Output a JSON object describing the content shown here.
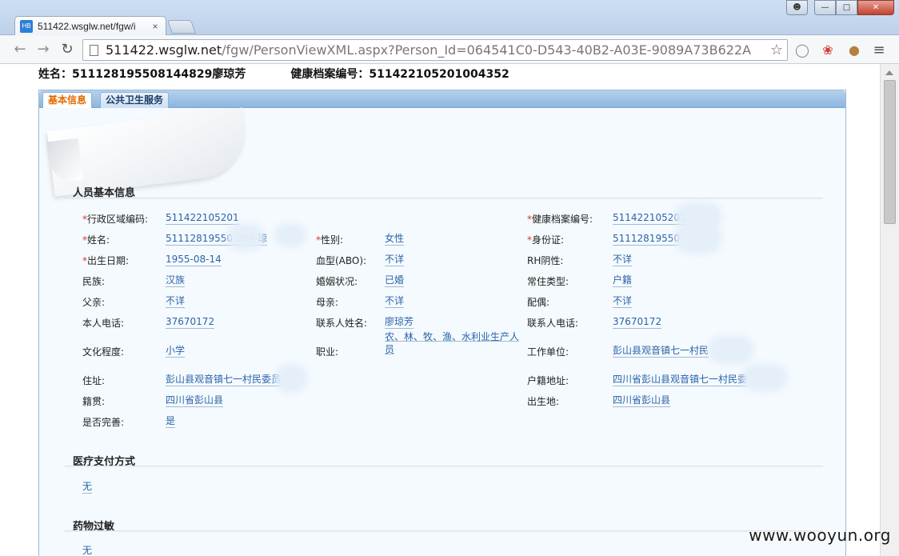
{
  "browser": {
    "tab_title": "511422.wsglw.net/fgw/i",
    "tab_close": "×",
    "favicon_text": "HB",
    "url_host": "511422.wsglw.net",
    "url_path": "/fgw/PersonViewXML.aspx?Person_Id=064541C0-D543-40B2-A03E-9089A73B622A",
    "back": "←",
    "forward": "→",
    "reload": "↻",
    "star": "☆",
    "menu": "≡",
    "icons": [
      "back-arrow-icon",
      "forward-arrow-icon",
      "reload-icon",
      "page-icon",
      "star-icon",
      "opera-icon",
      "hub-icon",
      "cookie-icon",
      "menu-icon"
    ]
  },
  "page": {
    "name_label": "姓名：",
    "name_value": "511128195508144829廖琼芳",
    "record_label": "健康档案编号：",
    "record_value": "511422105201004352",
    "tabs": [
      "基本信息",
      "公共卫生服务"
    ]
  },
  "sections": {
    "basic": "人员基本信息",
    "payment": "医疗支付方式",
    "allergy": "药物过敏"
  },
  "fields": {
    "region_code_label": "行政区域编码:",
    "region_code": "511422105201",
    "health_no_label": "健康档案编号:",
    "health_no": "511422105201",
    "name_label": "姓名:",
    "name": "51112819550        29廖琼",
    "gender_label": "性别:",
    "gender": "女性",
    "id_label": "身份证:",
    "id": "51112819550",
    "birth_label": "出生日期:",
    "birth": "1955-08-14",
    "blood_label": "血型(ABO):",
    "blood": "不详",
    "rh_label": "RH阴性:",
    "rh": "不详",
    "ethnic_label": "民族:",
    "ethnic": "汉族",
    "marital_label": "婚姻状况:",
    "marital": "已婚",
    "residence_label": "常住类型:",
    "residence": "户籍",
    "father_label": "父亲:",
    "father": "不详",
    "mother_label": "母亲:",
    "mother": "不详",
    "spouse_label": "配偶:",
    "spouse": "不详",
    "phone_label": "本人电话:",
    "phone": "37670172",
    "contact_label": "联系人姓名:",
    "contact": "廖琼芳",
    "contact_phone_label": "联系人电话:",
    "contact_phone": "37670172",
    "education_label": "文化程度:",
    "education": "小学",
    "occupation_label": "职业:",
    "occupation": "农、林、牧、渔、水利业生产人员",
    "workplace_label": "工作单位:",
    "workplace": "彭山县观音镇七一村民",
    "address_label": "住址:",
    "address": "彭山县观音镇七一村民委员",
    "hukou_label": "户籍地址:",
    "hukou": "四川省彭山县观音镇七一村民委",
    "native_label": "籍贯:",
    "native": "四川省彭山县",
    "birthplace_label": "出生地:",
    "birthplace": "四川省彭山县",
    "complete_label": "是否完善:",
    "complete": "是",
    "payment_value": "无",
    "allergy_value": "无"
  },
  "watermark": "www.wooyun.org"
}
